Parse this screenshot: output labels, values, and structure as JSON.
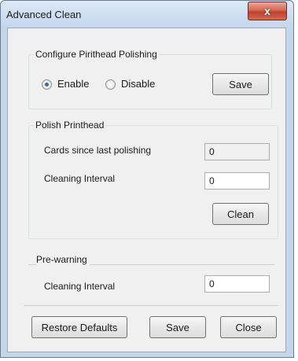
{
  "window": {
    "title": "Advanced Clean",
    "close_glyph": "x"
  },
  "polishing_config": {
    "group_title": "Configure Pirithead Polishing",
    "enable_label": "Enable",
    "disable_label": "Disable",
    "selected": "Enable",
    "save_label": "Save"
  },
  "polish_printhead": {
    "group_title": "Polish Printhead",
    "cards_since_label": "Cards since last polishing",
    "cards_since_value": "0",
    "interval_label": "Cleaning Interval",
    "interval_value": "0",
    "clean_label": "Clean"
  },
  "prewarning": {
    "group_title": "Pre-warning",
    "interval_label": "Cleaning Interval",
    "interval_value": "0"
  },
  "footer": {
    "restore_label": "Restore Defaults",
    "save_label": "Save",
    "close_label": "Close"
  },
  "icons": {
    "close": "close-icon",
    "radio": "radio-button"
  }
}
